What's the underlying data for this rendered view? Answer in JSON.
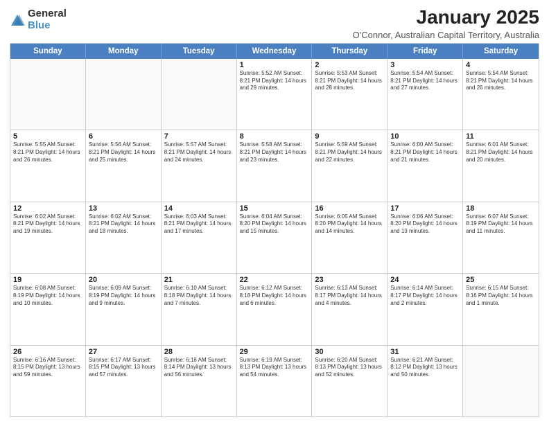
{
  "logo": {
    "general": "General",
    "blue": "Blue"
  },
  "title": "January 2025",
  "subtitle": "O'Connor, Australian Capital Territory, Australia",
  "weekdays": [
    "Sunday",
    "Monday",
    "Tuesday",
    "Wednesday",
    "Thursday",
    "Friday",
    "Saturday"
  ],
  "weeks": [
    [
      {
        "day": "",
        "info": ""
      },
      {
        "day": "",
        "info": ""
      },
      {
        "day": "",
        "info": ""
      },
      {
        "day": "1",
        "info": "Sunrise: 5:52 AM\nSunset: 8:21 PM\nDaylight: 14 hours\nand 29 minutes."
      },
      {
        "day": "2",
        "info": "Sunrise: 5:53 AM\nSunset: 8:21 PM\nDaylight: 14 hours\nand 28 minutes."
      },
      {
        "day": "3",
        "info": "Sunrise: 5:54 AM\nSunset: 8:21 PM\nDaylight: 14 hours\nand 27 minutes."
      },
      {
        "day": "4",
        "info": "Sunrise: 5:54 AM\nSunset: 8:21 PM\nDaylight: 14 hours\nand 26 minutes."
      }
    ],
    [
      {
        "day": "5",
        "info": "Sunrise: 5:55 AM\nSunset: 8:21 PM\nDaylight: 14 hours\nand 26 minutes."
      },
      {
        "day": "6",
        "info": "Sunrise: 5:56 AM\nSunset: 8:21 PM\nDaylight: 14 hours\nand 25 minutes."
      },
      {
        "day": "7",
        "info": "Sunrise: 5:57 AM\nSunset: 8:21 PM\nDaylight: 14 hours\nand 24 minutes."
      },
      {
        "day": "8",
        "info": "Sunrise: 5:58 AM\nSunset: 8:21 PM\nDaylight: 14 hours\nand 23 minutes."
      },
      {
        "day": "9",
        "info": "Sunrise: 5:59 AM\nSunset: 8:21 PM\nDaylight: 14 hours\nand 22 minutes."
      },
      {
        "day": "10",
        "info": "Sunrise: 6:00 AM\nSunset: 8:21 PM\nDaylight: 14 hours\nand 21 minutes."
      },
      {
        "day": "11",
        "info": "Sunrise: 6:01 AM\nSunset: 8:21 PM\nDaylight: 14 hours\nand 20 minutes."
      }
    ],
    [
      {
        "day": "12",
        "info": "Sunrise: 6:02 AM\nSunset: 8:21 PM\nDaylight: 14 hours\nand 19 minutes."
      },
      {
        "day": "13",
        "info": "Sunrise: 6:02 AM\nSunset: 8:21 PM\nDaylight: 14 hours\nand 18 minutes."
      },
      {
        "day": "14",
        "info": "Sunrise: 6:03 AM\nSunset: 8:21 PM\nDaylight: 14 hours\nand 17 minutes."
      },
      {
        "day": "15",
        "info": "Sunrise: 6:04 AM\nSunset: 8:20 PM\nDaylight: 14 hours\nand 15 minutes."
      },
      {
        "day": "16",
        "info": "Sunrise: 6:05 AM\nSunset: 8:20 PM\nDaylight: 14 hours\nand 14 minutes."
      },
      {
        "day": "17",
        "info": "Sunrise: 6:06 AM\nSunset: 8:20 PM\nDaylight: 14 hours\nand 13 minutes."
      },
      {
        "day": "18",
        "info": "Sunrise: 6:07 AM\nSunset: 8:19 PM\nDaylight: 14 hours\nand 11 minutes."
      }
    ],
    [
      {
        "day": "19",
        "info": "Sunrise: 6:08 AM\nSunset: 8:19 PM\nDaylight: 14 hours\nand 10 minutes."
      },
      {
        "day": "20",
        "info": "Sunrise: 6:09 AM\nSunset: 8:19 PM\nDaylight: 14 hours\nand 9 minutes."
      },
      {
        "day": "21",
        "info": "Sunrise: 6:10 AM\nSunset: 8:18 PM\nDaylight: 14 hours\nand 7 minutes."
      },
      {
        "day": "22",
        "info": "Sunrise: 6:12 AM\nSunset: 8:18 PM\nDaylight: 14 hours\nand 6 minutes."
      },
      {
        "day": "23",
        "info": "Sunrise: 6:13 AM\nSunset: 8:17 PM\nDaylight: 14 hours\nand 4 minutes."
      },
      {
        "day": "24",
        "info": "Sunrise: 6:14 AM\nSunset: 8:17 PM\nDaylight: 14 hours\nand 2 minutes."
      },
      {
        "day": "25",
        "info": "Sunrise: 6:15 AM\nSunset: 8:16 PM\nDaylight: 14 hours\nand 1 minute."
      }
    ],
    [
      {
        "day": "26",
        "info": "Sunrise: 6:16 AM\nSunset: 8:15 PM\nDaylight: 13 hours\nand 59 minutes."
      },
      {
        "day": "27",
        "info": "Sunrise: 6:17 AM\nSunset: 8:15 PM\nDaylight: 13 hours\nand 57 minutes."
      },
      {
        "day": "28",
        "info": "Sunrise: 6:18 AM\nSunset: 8:14 PM\nDaylight: 13 hours\nand 56 minutes."
      },
      {
        "day": "29",
        "info": "Sunrise: 6:19 AM\nSunset: 8:13 PM\nDaylight: 13 hours\nand 54 minutes."
      },
      {
        "day": "30",
        "info": "Sunrise: 6:20 AM\nSunset: 8:13 PM\nDaylight: 13 hours\nand 52 minutes."
      },
      {
        "day": "31",
        "info": "Sunrise: 6:21 AM\nSunset: 8:12 PM\nDaylight: 13 hours\nand 50 minutes."
      },
      {
        "day": "",
        "info": ""
      }
    ]
  ]
}
